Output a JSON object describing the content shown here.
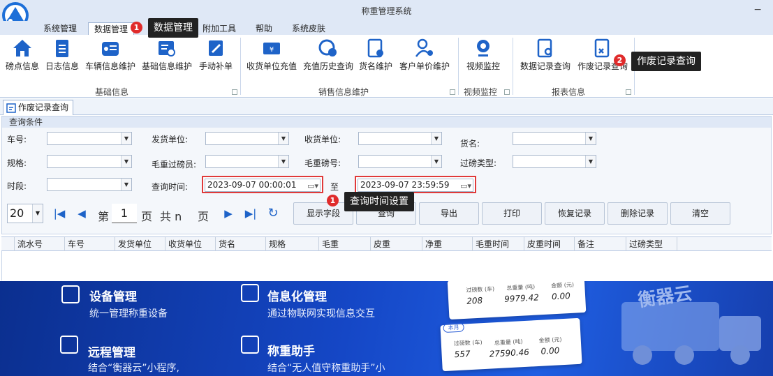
{
  "app": {
    "title": "称重管理系统",
    "minimize": "−"
  },
  "menu": [
    {
      "label": "系统管理"
    },
    {
      "label": "数据管理"
    },
    {
      "label": "附加工具"
    },
    {
      "label": "帮助"
    },
    {
      "label": "系统皮肤"
    }
  ],
  "ribbon": {
    "buttons": [
      {
        "label": "磅点信息",
        "icon": "home-icon"
      },
      {
        "label": "日志信息",
        "icon": "clipboard-icon"
      },
      {
        "label": "车辆信息维护",
        "icon": "truck-list-icon"
      },
      {
        "label": "基础信息维护",
        "icon": "edit-list-icon"
      },
      {
        "label": "手动补单",
        "icon": "pen-icon"
      },
      {
        "label": "收货单位充值",
        "icon": "wallet-icon"
      },
      {
        "label": "充值历史查询",
        "icon": "yuan-clock-icon"
      },
      {
        "label": "货名维护",
        "icon": "doc-gear-icon"
      },
      {
        "label": "客户单价维护",
        "icon": "user-gear-icon"
      },
      {
        "label": "视频监控",
        "icon": "webcam-icon"
      },
      {
        "label": "数据记录查询",
        "icon": "doc-search-icon"
      },
      {
        "label": "作废记录查询",
        "icon": "doc-cancel-icon"
      }
    ],
    "groups": [
      {
        "label": "基础信息"
      },
      {
        "label": "销售信息维护"
      },
      {
        "label": "视频监控"
      },
      {
        "label": "报表信息"
      }
    ]
  },
  "doc_tab": {
    "label": "作废记录查询"
  },
  "query": {
    "section_title": "查询条件",
    "labels": {
      "plate": "车号:",
      "sender": "发货单位:",
      "receiver": "收货单位:",
      "goods": "货名:",
      "spec": "规格:",
      "gross_operator": "毛重过磅员:",
      "gross_scale": "毛重磅号:",
      "weigh_type": "过磅类型:",
      "period": "时段:",
      "query_time": "查询时间:",
      "to": "至"
    },
    "start_time": "2023-09-07 00:00:01",
    "end_time": "2023-09-07 23:59:59"
  },
  "pager": {
    "page_size": "20",
    "page_prefix": "第",
    "page_number": "1",
    "page_suffix": "页",
    "total_prefix": "共 n",
    "total_suffix": "页"
  },
  "actions": [
    {
      "label": "显示字段"
    },
    {
      "label": "查询"
    },
    {
      "label": "导出"
    },
    {
      "label": "打印"
    },
    {
      "label": "恢复记录"
    },
    {
      "label": "删除记录"
    },
    {
      "label": "清空"
    }
  ],
  "grid_columns": [
    "流水号",
    "车号",
    "发货单位",
    "收货单位",
    "货名",
    "规格",
    "毛重",
    "皮重",
    "净重",
    "毛重时间",
    "皮重时间",
    "备注",
    "过磅类型"
  ],
  "annotations": [
    {
      "badge": "1",
      "text": "数据管理"
    },
    {
      "badge": "2",
      "text": "作废记录查询"
    },
    {
      "badge": "1",
      "text": "查询时间设置"
    }
  ],
  "colors": {
    "badge": "#e02b2b",
    "tooltip_bg": "#222222",
    "highlight": "#e03a3a",
    "ribbon_blue": "#1e63c8"
  },
  "banner": {
    "features": [
      {
        "title": "设备管理",
        "desc": "统一管理称重设备",
        "icon": "device-icon"
      },
      {
        "title": "信息化管理",
        "desc": "通过物联网实现信息交互",
        "icon": "info-icon"
      },
      {
        "title": "远程管理",
        "desc": "结合“衡器云”小程序,",
        "icon": "remote-icon"
      },
      {
        "title": "称重助手",
        "desc": "结合“无人值守称重助手”小",
        "icon": "assistant-icon"
      }
    ],
    "card1": {
      "labels": [
        "过磅数 (车)",
        "总重量 (吨)",
        "金额 (元)"
      ],
      "values": [
        "208",
        "9979.42",
        "0.00"
      ]
    },
    "card2": {
      "pill": "本月",
      "labels": [
        "过磅数 (车)",
        "总重量 (吨)",
        "金额 (元)"
      ],
      "values": [
        "557",
        "27590.46",
        "0.00"
      ]
    },
    "cloud_title": "衡器云"
  }
}
